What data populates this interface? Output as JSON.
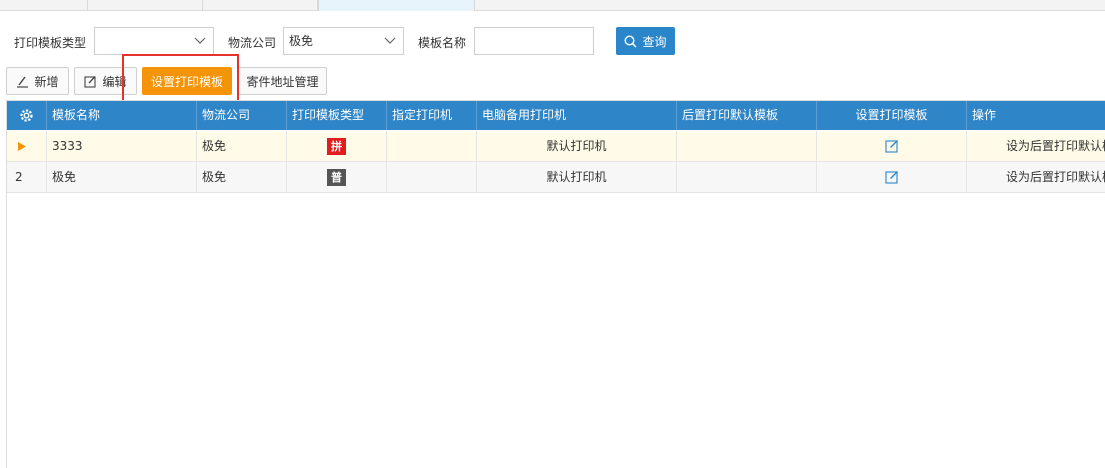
{
  "filters": {
    "template_type_label": "打印模板类型",
    "template_type_value": "",
    "logistics_label": "物流公司",
    "logistics_value": "极免",
    "template_name_label": "模板名称",
    "template_name_value": "",
    "query_label": "查询"
  },
  "toolbar": {
    "add_label": "新增",
    "edit_label": "编辑",
    "set_template_label": "设置打印模板",
    "sender_address_label": "寄件地址管理"
  },
  "grid": {
    "columns": [
      "模板名称",
      "物流公司",
      "打印模板类型",
      "指定打印机",
      "电脑备用打印机",
      "后置打印默认模板",
      "设置打印模板",
      "操作"
    ],
    "rows": [
      {
        "index": "",
        "name": "3333",
        "company": "极免",
        "type_badge": "拼",
        "printer": "",
        "backup_printer": "默认打印机",
        "post_template": "",
        "action": "设为后置打印默认模"
      },
      {
        "index": "2",
        "name": "极免",
        "company": "极免",
        "type_badge": "普",
        "printer": "",
        "backup_printer": "默认打印机",
        "post_template": "",
        "action": "设为后置打印默认模"
      }
    ]
  },
  "colors": {
    "header_blue": "#2e85c8",
    "accent_orange": "#f59309",
    "badge_red": "#e01e1e",
    "badge_dark": "#555555",
    "highlight_red": "#e8302c"
  }
}
